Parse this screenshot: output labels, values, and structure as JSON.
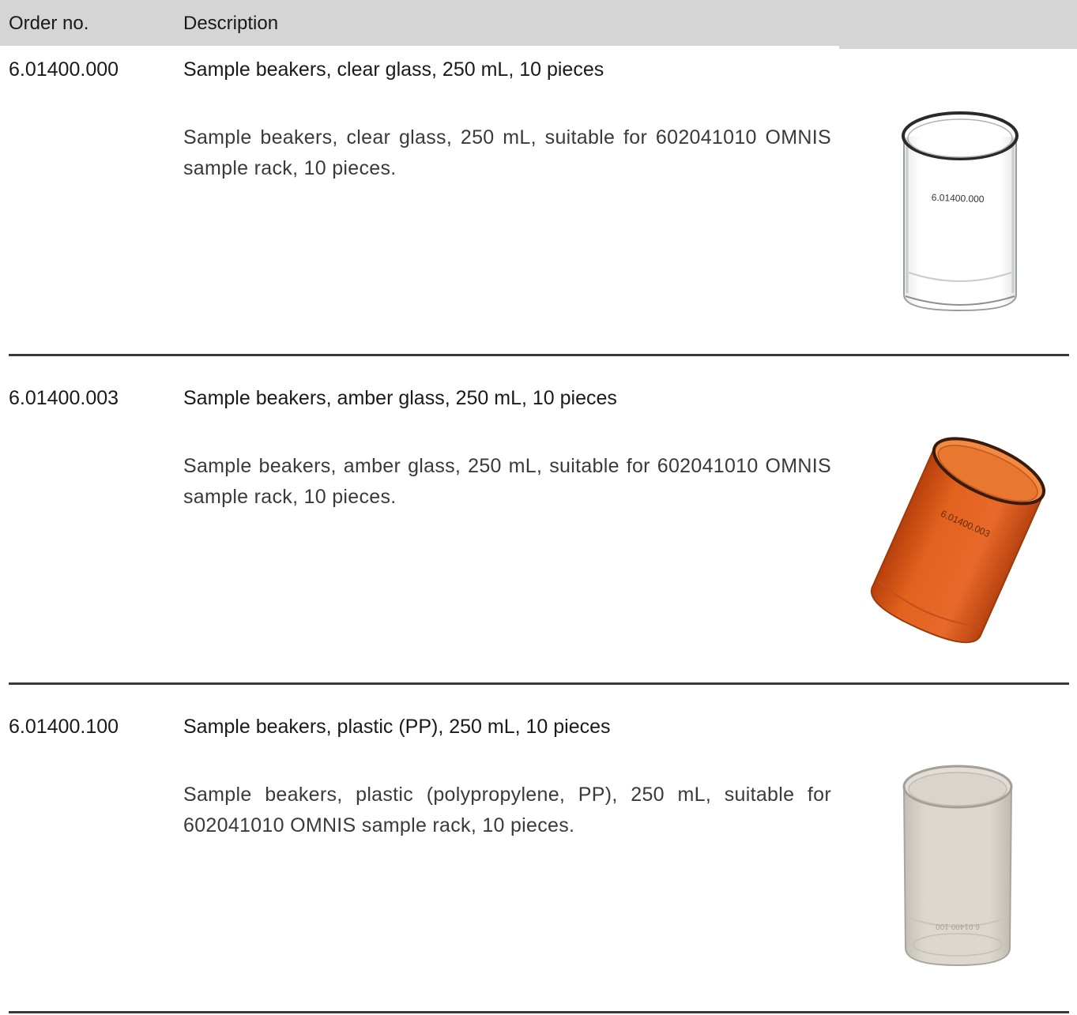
{
  "table": {
    "header": {
      "order_no": "Order no.",
      "description": "Description"
    },
    "rows": [
      {
        "order_no": "6.01400.000",
        "title": "Sample beakers, clear glass, 250 mL, 10 pieces",
        "description": "Sample beakers, clear glass, 250 mL, suitable for 602041010 OMNIS sample rack, 10 pieces.",
        "image_label": "6.01400.000",
        "image": "clear-glass-beaker"
      },
      {
        "order_no": "6.01400.003",
        "title": "Sample beakers, amber glass, 250 mL, 10 pieces",
        "description": "Sample beakers, amber glass, 250 mL, suitable for 602041010 OMNIS sample rack, 10 pieces.",
        "image_label": "6.01400.003",
        "image": "amber-glass-beaker"
      },
      {
        "order_no": "6.01400.100",
        "title": "Sample beakers, plastic (PP), 250 mL, 10 pieces",
        "description": "Sample beakers, plastic (polypropylene, PP), 250 mL, suitable for 602041010 OMNIS sample rack, 10 pieces.",
        "image_label": "6.01400.100",
        "image": "plastic-pp-beaker"
      }
    ]
  },
  "colors": {
    "header_bg": "#d4d5d4",
    "divider": "#3a3a3a",
    "text": "#1a1a1a",
    "amber": "#d9531a"
  }
}
